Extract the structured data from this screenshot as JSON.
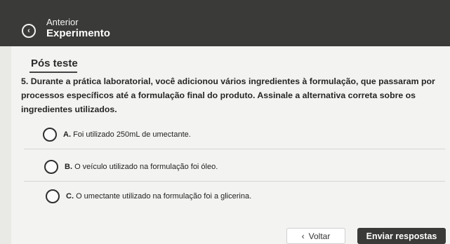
{
  "header": {
    "prev_label": "Anterior",
    "title": "Experimento"
  },
  "section": {
    "title": "Pós teste"
  },
  "question": {
    "number": "5.",
    "text": "Durante a prática laboratorial, você adicionou vários ingredientes à formulação, que passaram por processos específicos até a formulação final do produto. Assinale a alternativa correta sobre os ingredientes utilizados."
  },
  "options": [
    {
      "letter": "A.",
      "text": "Foi utilizado 250mL de umectante."
    },
    {
      "letter": "B.",
      "text": "O veículo utilizado na formulação foi óleo."
    },
    {
      "letter": "C.",
      "text": "O umectante utilizado na formulação foi a glicerina."
    }
  ],
  "actions": {
    "back_label": "Voltar",
    "submit_label": "Enviar respostas"
  },
  "icons": {
    "back": "chevron-left-circle-icon",
    "voltar": "chevron-left-icon"
  }
}
